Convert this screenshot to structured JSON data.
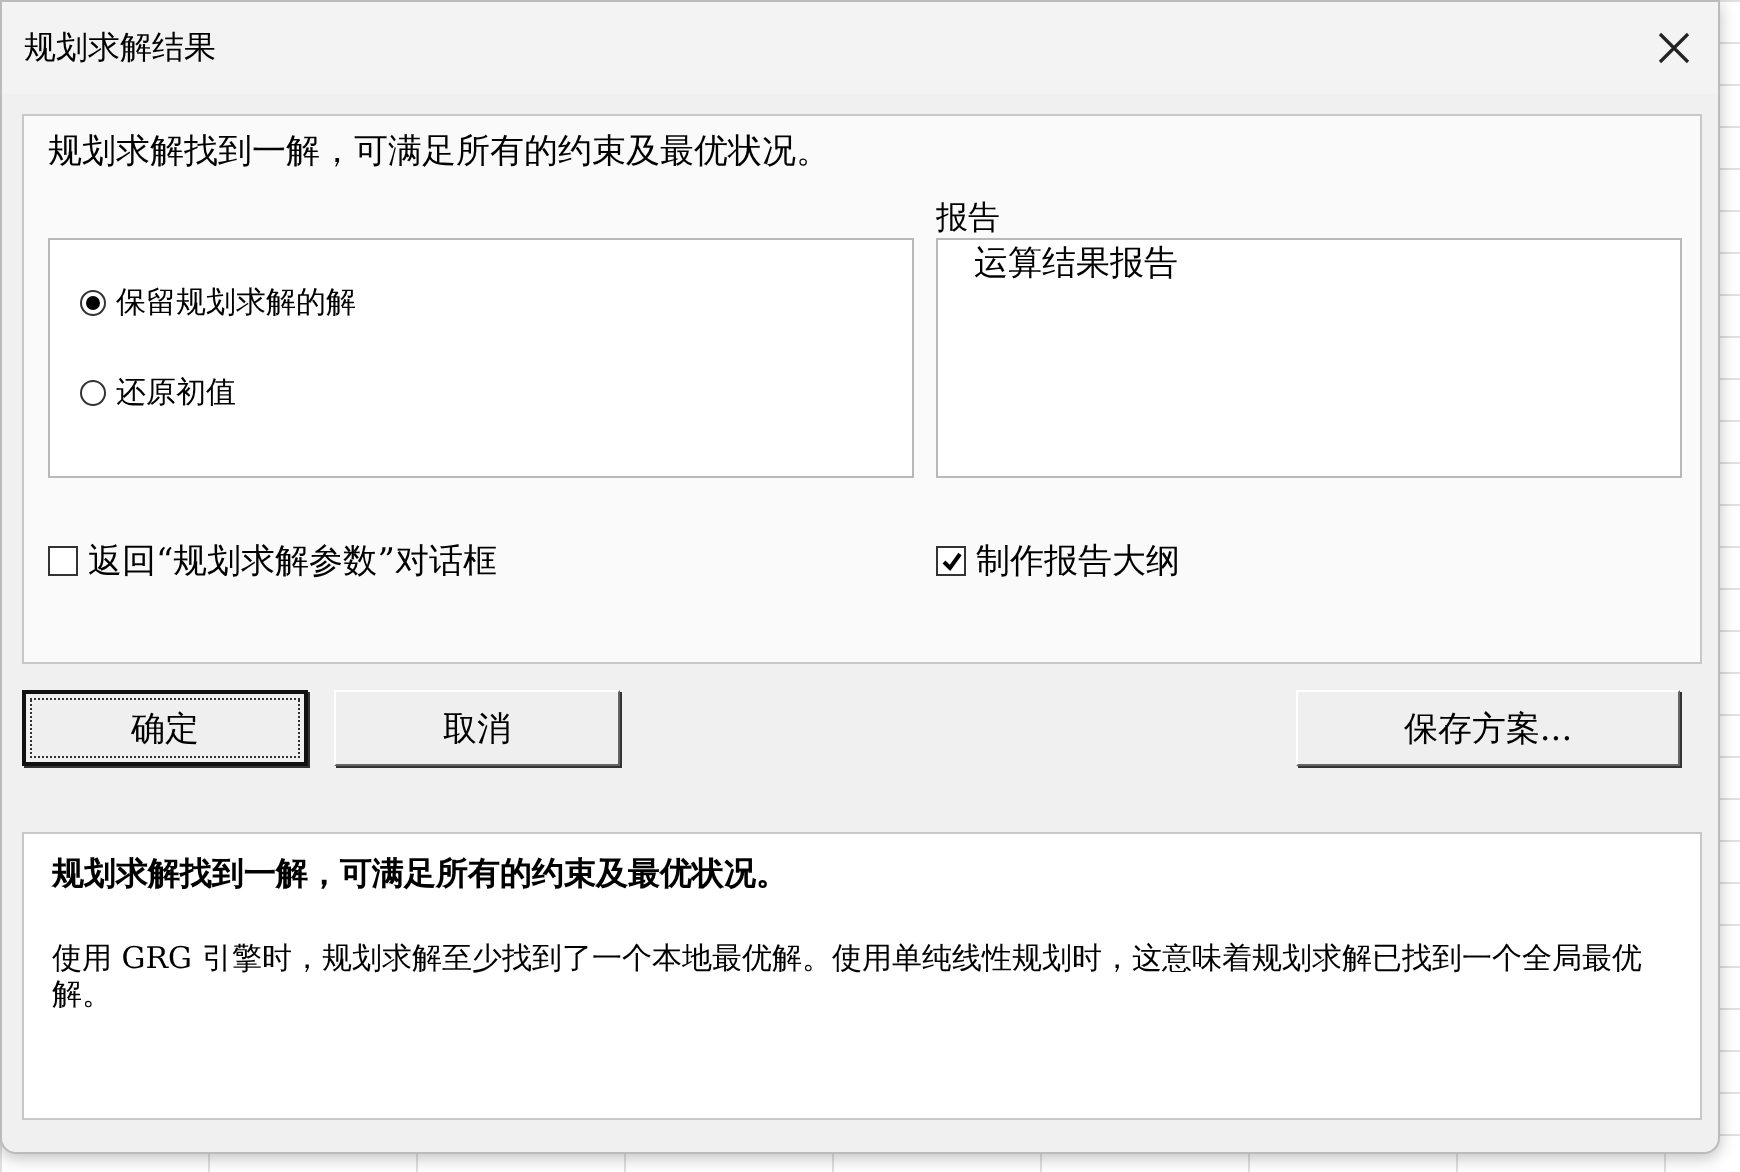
{
  "window": {
    "title": "规划求解结果"
  },
  "message": "规划求解找到一解，可满足所有的约束及最优状况。",
  "options": [
    {
      "label": "保留规划求解的解",
      "selected": true
    },
    {
      "label": "还原初值",
      "selected": false
    }
  ],
  "return_dialog": {
    "label": "返回“规划求解参数”对话框",
    "checked": false
  },
  "reports": {
    "label": "报告",
    "items": [
      {
        "label": "运算结果报告",
        "selected": false
      }
    ]
  },
  "outline": {
    "label": "制作报告大纲",
    "checked": true
  },
  "buttons": [
    {
      "label": "确定",
      "kind": "default"
    },
    {
      "label": "取消",
      "kind": "normal"
    },
    {
      "label": "保存方案...",
      "kind": "normal"
    }
  ],
  "details": {
    "heading": "规划求解找到一解，可满足所有的约束及最优状况。",
    "text": "使用 GRG 引擎时，规划求解至少找到了一个本地最优解。使用单纯线性规划时，这意味着规划求解已找到一个全局最优解。"
  }
}
